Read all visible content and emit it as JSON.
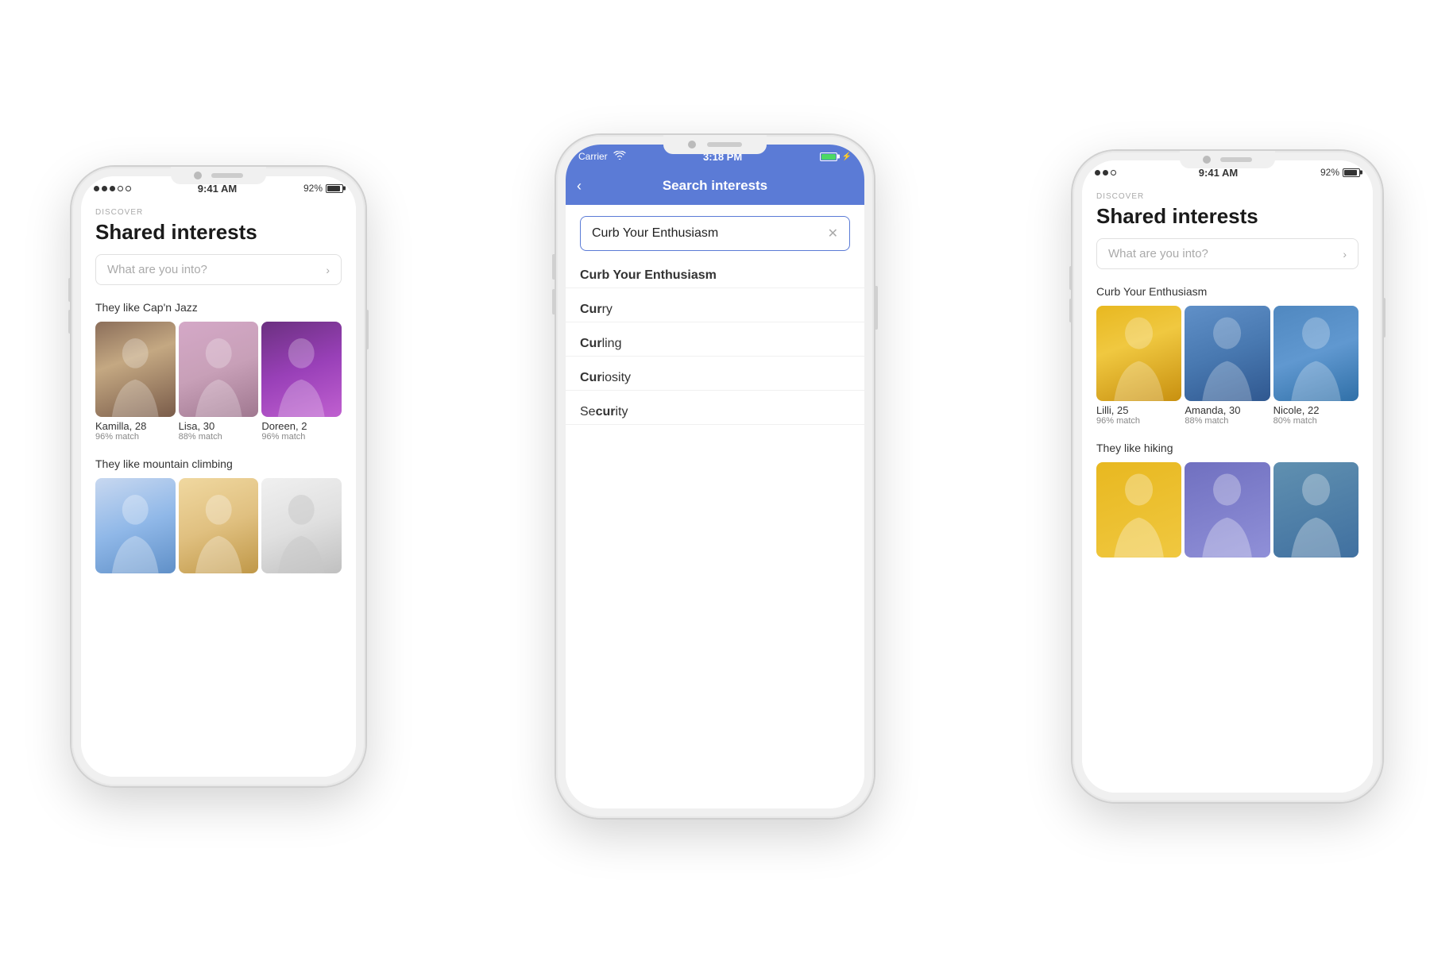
{
  "phones": {
    "left": {
      "status": {
        "signal": "●●●○○",
        "time": "9:41 AM",
        "battery": "92%"
      },
      "screen": "discover",
      "discover_label": "DISCOVER",
      "title": "Shared interests",
      "search_placeholder": "What are you into?",
      "sections": [
        {
          "label": "They like Cap'n Jazz",
          "profiles": [
            {
              "name": "Kamilla, 28",
              "match": "96% match",
              "color": "kamilla"
            },
            {
              "name": "Lisa, 30",
              "match": "88% match",
              "color": "lisa"
            },
            {
              "name": "Doreen, 2",
              "match": "96% match",
              "color": "doreen"
            }
          ]
        },
        {
          "label": "They like mountain climbing",
          "profiles": [
            {
              "name": "",
              "match": "",
              "color": "mc1"
            },
            {
              "name": "",
              "match": "",
              "color": "mc2"
            },
            {
              "name": "",
              "match": "",
              "color": "mc3"
            }
          ]
        }
      ]
    },
    "center": {
      "status": {
        "carrier": "Carrier",
        "wifi": true,
        "time": "3:18 PM",
        "battery_full": true
      },
      "screen": "search",
      "header_title": "Search interests",
      "back_label": "‹",
      "search_value": "Curb Your Enthusiasm",
      "clear_btn": "✕",
      "results": [
        {
          "bold": "Curb Your Enthusiasm",
          "rest": ""
        },
        {
          "bold": "Cur",
          "rest": "ry"
        },
        {
          "bold": "Cur",
          "rest": "ling"
        },
        {
          "bold": "Cur",
          "rest": "iosity"
        },
        {
          "bold": "Se",
          "rest": "cur",
          "suffix": "ity"
        }
      ]
    },
    "right": {
      "status": {
        "signal": "●●○",
        "time": "9:41 AM",
        "battery": "92%"
      },
      "screen": "discover",
      "discover_label": "DISCOVER",
      "title": "Shared interests",
      "search_placeholder": "What are you into?",
      "sections": [
        {
          "label": "Curb Your Enthusiasm",
          "profiles": [
            {
              "name": "Lilli, 25",
              "match": "96% match",
              "color": "lilli"
            },
            {
              "name": "Amanda, 30",
              "match": "88% match",
              "color": "amanda"
            },
            {
              "name": "Nicole, 22",
              "match": "80% match",
              "color": "nicole"
            }
          ]
        },
        {
          "label": "They like hiking",
          "profiles": [
            {
              "name": "",
              "match": "",
              "color": "h1"
            },
            {
              "name": "",
              "match": "",
              "color": "h2"
            },
            {
              "name": "",
              "match": "",
              "color": "h3"
            }
          ]
        }
      ]
    }
  }
}
